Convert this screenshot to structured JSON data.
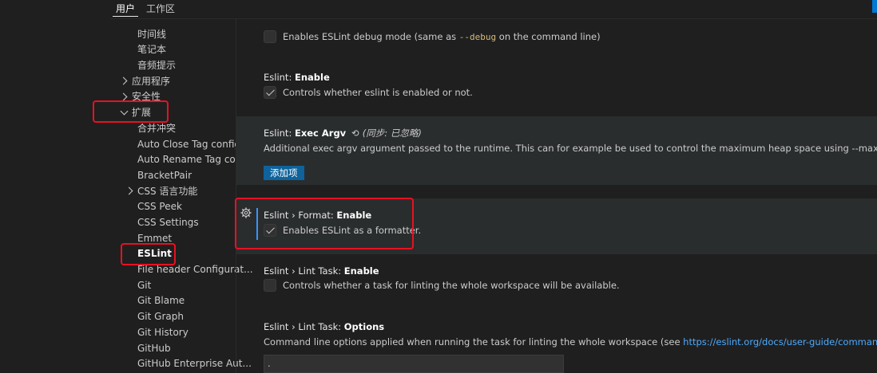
{
  "tabs": {
    "user": "用户",
    "workspace": "工作区"
  },
  "tree": {
    "timeline": "时间线",
    "notebook": "笔记本",
    "audio_cues": "音频提示",
    "applications": "应用程序",
    "security": "安全性",
    "extensions": "扩展",
    "merge_conflict": "合并冲突",
    "auto_close_tag": "Auto Close Tag config...",
    "auto_rename_tag": "Auto Rename Tag con...",
    "bracket_pair": "BracketPair",
    "css_lang": "CSS 语言功能",
    "css_peek": "CSS Peek",
    "css_settings": "CSS Settings",
    "emmet": "Emmet",
    "eslint": "ESLint",
    "file_header": "File header Configurat...",
    "git": "Git",
    "git_blame": "Git Blame",
    "git_graph": "Git Graph",
    "git_history": "Git History",
    "github": "GitHub",
    "github_enterprise": "GitHub Enterprise Aut..."
  },
  "settings": {
    "debug": {
      "desc_pre": "Enables ESLint debug mode (same as ",
      "code": "--debug",
      "desc_post": " on the command line)",
      "checked": false
    },
    "enable": {
      "prefix": "Eslint: ",
      "name": "Enable",
      "desc": "Controls whether eslint is enabled or not.",
      "checked": true
    },
    "exec_argv": {
      "prefix": "Eslint: ",
      "name": "Exec Argv",
      "sync": "(同步: 已忽略)",
      "desc": "Additional exec argv argument passed to the runtime. This can for example be used to control the maximum heap space using --max_old_space_size",
      "button": "添加项"
    },
    "format_enable": {
      "prefix": "Eslint › Format: ",
      "name": "Enable",
      "desc": "Enables ESLint as a formatter.",
      "checked": true
    },
    "lint_task_enable": {
      "prefix": "Eslint › Lint Task: ",
      "name": "Enable",
      "desc": "Controls whether a task for linting the whole workspace will be available.",
      "checked": false
    },
    "lint_task_options": {
      "prefix": "Eslint › Lint Task: ",
      "name": "Options",
      "desc_pre": "Command line options applied when running the task for linting the whole workspace (see ",
      "link": "https://eslint.org/docs/user-guide/command-line-interface",
      "value": "."
    }
  },
  "colors": {
    "background": "#1f1f1f",
    "accent_button": "#0e639c",
    "link": "#4daafc",
    "annotation_red": "#e81123",
    "focus_edge": "#3794ff"
  }
}
